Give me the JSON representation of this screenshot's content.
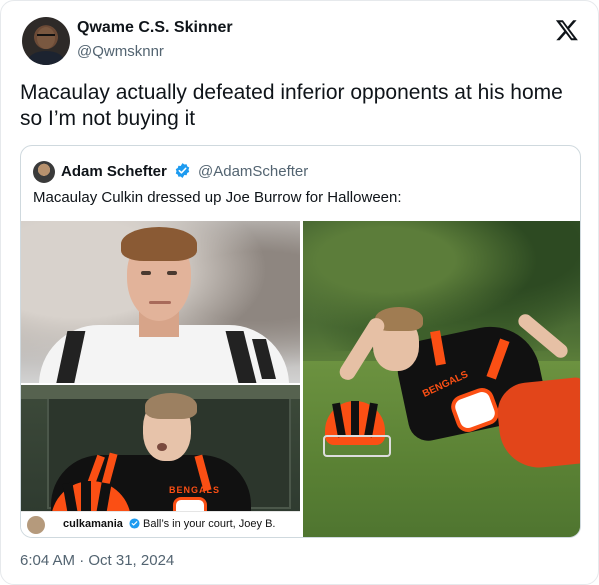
{
  "tweet": {
    "author_name": "Qwame C.S. Skinner",
    "author_handle": "@Qwmsknnr",
    "text": "Macaulay actually defeated inferior opponents at his home so I’m not buying it",
    "timestamp": "6:04 AM · Oct 31, 2024"
  },
  "quote": {
    "author_name": "Adam Schefter",
    "author_handle": "@AdamSchefter",
    "text": "Macaulay Culkin dressed up Joe Burrow for Halloween:",
    "image_caption": {
      "user": "culkamania",
      "text": "Ball’s in your court, Joey B."
    },
    "jersey_text": "BENGALS"
  },
  "icons": {
    "brand": "x-logo-icon",
    "verified": "verified-badge-icon"
  },
  "colors": {
    "verified": "#1d9bf0",
    "bengals_orange": "#fb4f14",
    "bengals_black": "#111111",
    "secondary_text": "#536471"
  }
}
